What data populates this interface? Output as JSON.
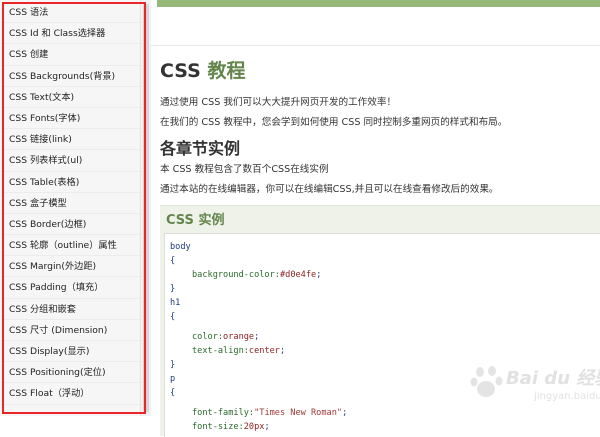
{
  "sidebar": {
    "items": [
      "CSS 语法",
      "CSS Id 和 Class选择器",
      "CSS 创建",
      "CSS Backgrounds(背景)",
      "CSS Text(文本)",
      "CSS Fonts(字体)",
      "CSS 链接(link)",
      "CSS 列表样式(ul)",
      "CSS Table(表格)",
      "CSS 盒子模型",
      "CSS Border(边框)",
      "CSS 轮廓（outline）属性",
      "CSS Margin(外边距)",
      "CSS Padding（填充）",
      "CSS 分组和嵌套",
      "CSS 尺寸 (Dimension)",
      "CSS Display(显示)",
      "CSS Positioning(定位)",
      "CSS Float（浮动）"
    ]
  },
  "main": {
    "title_prefix": "CSS",
    "title_accent": "教程",
    "intro1": "通过使用 CSS 我们可以大大提升网页开发的工作效率！",
    "intro2": "在我们的 CSS 教程中，您会学到如何使用 CSS 同时控制多重网页的样式和布局。",
    "section_title": "各章节实例",
    "section_p1": "本 CSS 教程包含了数百个CSS在线实例",
    "section_p2": "通过本站的在线编辑器，你可以在线编辑CSS,并且可以在线查看修改后的效果。",
    "example_title": "CSS 实例",
    "code": {
      "l1": "body",
      "l2": "{",
      "l3_prop": "background-color:",
      "l3_val": "#d0e4fe",
      "l3_end": ";",
      "l4": "}",
      "l5": "h1",
      "l6": "{",
      "l7_prop": "color:",
      "l7_val": "orange",
      "l7_end": ";",
      "l8_prop": "text-align:",
      "l8_val": "center",
      "l8_end": ";",
      "l9": "}",
      "l10": "p",
      "l11": "{",
      "l12_prop": "font-family:",
      "l12_val": "\"Times New Roman\"",
      "l12_end": ";",
      "l13_prop": "font-size:",
      "l13_val": "20px",
      "l13_end": ";"
    }
  },
  "watermark": {
    "text": "Bai du 经验",
    "sub": "jingyan.baidu.com"
  },
  "colors": {
    "accent": "#64854c",
    "top_bar": "#96b97a",
    "highlight": "#e8262a",
    "example_bg": "#eef2e8"
  }
}
